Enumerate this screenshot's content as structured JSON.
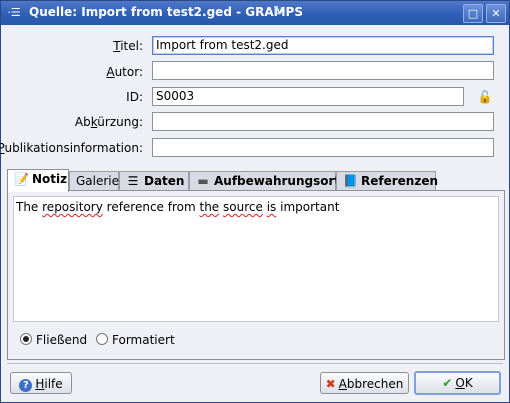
{
  "window": {
    "title": "Quelle: Import from test2.ged - GRAMPS",
    "menu_glyph": "·☰",
    "swirl_glyph": "↻",
    "maximize_glyph": "□",
    "close_glyph": "✕"
  },
  "form": {
    "titel": {
      "label_u": "T",
      "label_rest": "itel:",
      "value": "Import from test2.ged"
    },
    "autor": {
      "label_u": "A",
      "label_rest": "utor:",
      "value": ""
    },
    "id": {
      "label": "ID:",
      "value": "S0003",
      "lock_glyph": "🔓"
    },
    "abkuerzung": {
      "label_pre": "Ab",
      "label_u": "k",
      "label_rest": "ürzung:",
      "value": ""
    },
    "publikation": {
      "label_u": "P",
      "label_rest": "ublikationsinformation:",
      "value": ""
    }
  },
  "tabs": [
    {
      "label": "Notiz",
      "icon": "📝",
      "active": true
    },
    {
      "label": "Galerie",
      "icon": "",
      "active": false
    },
    {
      "label": "Daten",
      "icon": "☰",
      "active": false
    },
    {
      "label": "Aufbewahrungsorte",
      "icon": "▬",
      "active": false
    },
    {
      "label": "Referenzen",
      "icon": "📘",
      "active": false
    }
  ],
  "note": {
    "before": "The ",
    "w1": "repository",
    "mid1": " reference from ",
    "w2": "the",
    "mid2": " ",
    "w3": "source",
    "mid3": " ",
    "w4": "is",
    "after": " important"
  },
  "format": {
    "option1": "Fließend",
    "option2": "Formatiert",
    "selected": "Fließend"
  },
  "buttons": {
    "help": {
      "icon": "?",
      "label_u": "H",
      "label_rest": "ilfe"
    },
    "cancel": {
      "icon": "✖",
      "label_u": "A",
      "label_rest": "bbrechen"
    },
    "ok": {
      "icon": "✔",
      "label_u": "O",
      "label_rest": "K"
    }
  },
  "colors": {
    "title_bar": "#2f5fb6",
    "cancel_icon": "#d23a1e",
    "ok_icon": "#2e9a1e"
  }
}
